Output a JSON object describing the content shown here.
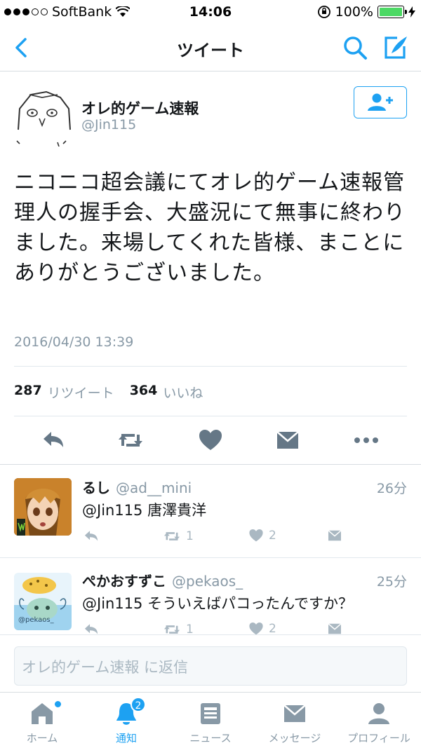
{
  "status_bar": {
    "carrier": "SoftBank",
    "time": "14:06",
    "battery": "100%",
    "battery_color": "#4cd964"
  },
  "nav": {
    "title": "ツイート",
    "back_icon": "chevron-left-icon",
    "search_icon": "search-icon",
    "compose_icon": "compose-icon"
  },
  "tweet": {
    "name": "オレ的ゲーム速報",
    "handle": "@Jin115",
    "text": "ニコニコ超会議にてオレ的ゲーム速報管理人の握手会、大盛況にて無事に終わりました。来場してくれた皆様、まことにありがとうございました。",
    "date": "2016/04/30 13:39",
    "retweet_count": "287",
    "retweet_label": "リツイート",
    "like_count": "364",
    "like_label": "いいね"
  },
  "replies": [
    {
      "name": "るし",
      "handle": "@ad__mini",
      "time": "26分",
      "text": "@Jin115 唐澤貴洋",
      "retweets": "1",
      "likes": "2"
    },
    {
      "name": "ぺかおすずこ",
      "handle": "@pekaos_",
      "time": "25分",
      "text": "@Jin115 そういえばパコったんですか？",
      "retweets": "1",
      "likes": "2",
      "avatar_caption": "@pekaos_"
    }
  ],
  "reply_box": {
    "placeholder": "オレ的ゲーム速報 に返信"
  },
  "tabs": [
    {
      "label": "ホーム",
      "icon": "home-icon"
    },
    {
      "label": "通知",
      "icon": "bell-icon",
      "badge": "2"
    },
    {
      "label": "ニュース",
      "icon": "news-icon"
    },
    {
      "label": "メッセージ",
      "icon": "mail-icon"
    },
    {
      "label": "プロフィール",
      "icon": "profile-icon"
    }
  ],
  "colors": {
    "accent": "#1da1f2",
    "muted": "#8899a6",
    "icon_gray": "#657786"
  }
}
